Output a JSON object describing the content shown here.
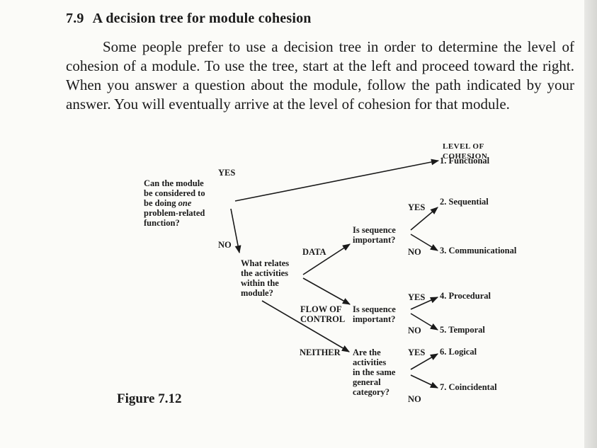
{
  "section": {
    "number": "7.9",
    "title": "A decision tree for module cohesion"
  },
  "paragraph": "Some people prefer to use a decision tree in order to determine the level of cohesion of a module. To use the tree, start at the left and proceed toward the right. When you answer a question about the module, follow the path indicated by your answer. You will eventually arrive at the level of cohesion for that module.",
  "tree": {
    "column_heading": [
      "LEVEL OF",
      "COHESION"
    ],
    "q1": [
      "Can the module",
      "be considered to",
      "be doing one",
      "problem-related",
      "function?"
    ],
    "q1_emphasis": "one",
    "q2": [
      "What relates",
      "the activities",
      "within the",
      "module?"
    ],
    "q3": [
      "Is sequence",
      "important?"
    ],
    "q4": [
      "Is sequence",
      "important?"
    ],
    "q5": [
      "Are the",
      "activities",
      "in the same",
      "general",
      "category?"
    ],
    "branch_yes": "YES",
    "branch_no": "NO",
    "branch_data": "DATA",
    "branch_flow": [
      "FLOW OF",
      "CONTROL"
    ],
    "branch_neither": "NEITHER",
    "outcomes": [
      "1. Functional",
      "2. Sequential",
      "3. Communicational",
      "4. Procedural",
      "5. Temporal",
      "6. Logical",
      "7. Coincidental"
    ]
  },
  "figure_caption": "Figure 7.12"
}
